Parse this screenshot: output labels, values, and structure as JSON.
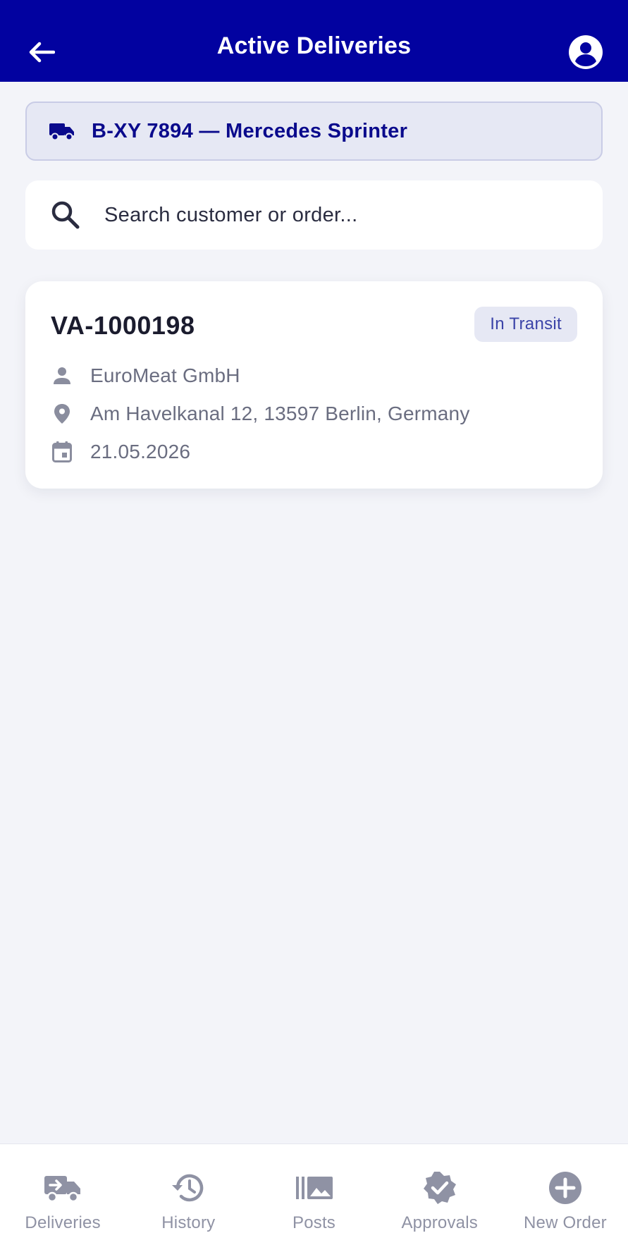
{
  "header": {
    "title": "Active Deliveries",
    "back_icon": "arrow-left-icon",
    "profile_icon": "account-circle-icon"
  },
  "vehicle": {
    "label": "B-XY 7894 — Mercedes Sprinter",
    "icon": "truck-icon"
  },
  "search": {
    "placeholder": "Search customer or order...",
    "value": "",
    "icon": "search-icon"
  },
  "deliveries": [
    {
      "order_id": "VA-1000198",
      "status": "In Transit",
      "customer": "EuroMeat GmbH",
      "address": "Am Havelkanal 12, 13597 Berlin, Germany",
      "date": "21.05.2026"
    }
  ],
  "bottom_nav": {
    "items": [
      {
        "label": "Deliveries",
        "icon": "truck-fast-icon"
      },
      {
        "label": "History",
        "icon": "history-icon"
      },
      {
        "label": "Posts",
        "icon": "photo-library-icon"
      },
      {
        "label": "Approvals",
        "icon": "verified-badge-icon"
      },
      {
        "label": "New Order",
        "icon": "add-circle-icon"
      }
    ]
  },
  "colors": {
    "header_bg": "#0202a0",
    "accent": "#0a0a8c",
    "badge_bg": "#e6e8f4",
    "badge_text": "#3b43a8",
    "muted_text": "#6a6d80",
    "nav_inactive": "#8f92a4",
    "page_bg": "#f3f4f9"
  }
}
